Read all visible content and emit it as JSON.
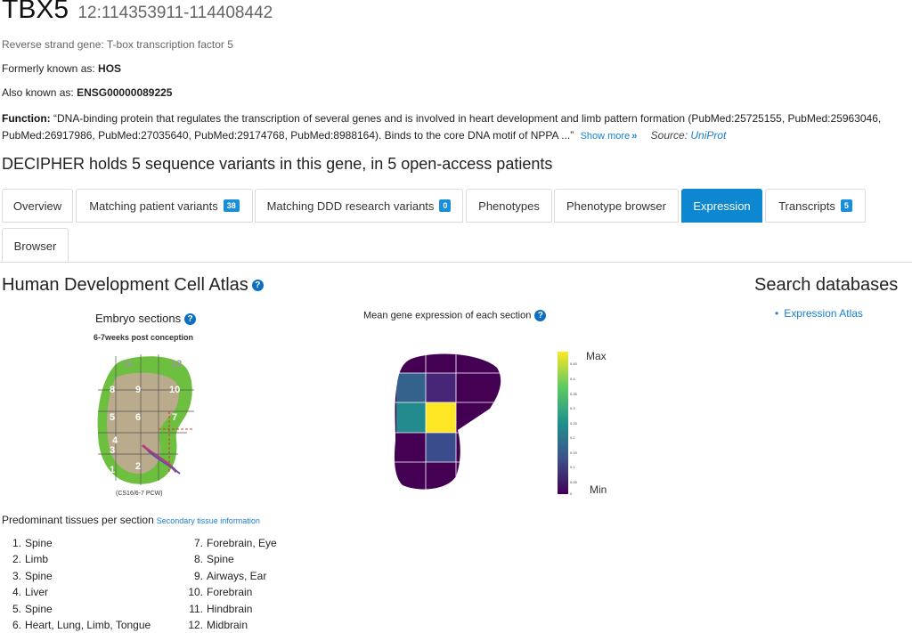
{
  "gene": {
    "symbol": "TBX5",
    "location": "12:114353911-114408442",
    "strand_text": "Reverse strand gene: T-box transcription factor 5",
    "formerly_label": "Formerly known as:",
    "formerly_value": "HOS",
    "aka_label": "Also known as:",
    "aka_value": "ENSG00000089225",
    "function_label": "Function:",
    "function_text": "“DNA-binding protein that regulates the transcription of several genes and is involved in heart development and limb pattern formation (PubMed:25725155, PubMed:25963046, PubMed:26917986, PubMed:27035640, PubMed:29174768, PubMed:8988164). Binds to the core DNA motif of NPPA ...”",
    "show_more": "Show more",
    "show_more_chevron": "»",
    "source_label": "Source:",
    "source_value": "UniProt"
  },
  "summary": "DECIPHER holds 5 sequence variants in this gene, in 5 open-access patients",
  "tabs": [
    {
      "label": "Overview",
      "badge": ""
    },
    {
      "label": "Matching patient variants",
      "badge": "38"
    },
    {
      "label": "Matching DDD research variants",
      "badge": "0"
    },
    {
      "label": "Phenotypes",
      "badge": ""
    },
    {
      "label": "Phenotype browser",
      "badge": ""
    },
    {
      "label": "Expression",
      "badge": "",
      "active": true
    },
    {
      "label": "Transcripts",
      "badge": "5"
    },
    {
      "label": "Browser",
      "badge": ""
    }
  ],
  "hdca": {
    "title": "Human Development Cell Atlas",
    "help": "?",
    "embryo_title": "Embryo sections",
    "embryo_sub": "6-7weeks post conception",
    "embryo_caption": "(CS16/6-7 PCW)",
    "embryo_section_numbers": [
      "1",
      "2",
      "3",
      "4",
      "5",
      "6",
      "7",
      "8",
      "9",
      "10",
      "11",
      "12"
    ],
    "mean_title": "Mean gene expression of each section",
    "legend_max": "Max",
    "legend_min": "Min",
    "legend_ticks": [
      "0.45",
      "0.4",
      "0.35",
      "0.3",
      "0.25",
      "0.2",
      "0.15",
      "0.1",
      "0.05",
      "0"
    ]
  },
  "search": {
    "title": "Search databases",
    "items": [
      "Expression Atlas"
    ]
  },
  "tissues": {
    "title": "Predominant tissues per section",
    "secondary_link": "Secondary tissue information",
    "col1": [
      {
        "n": "1.",
        "t": "Spine"
      },
      {
        "n": "2.",
        "t": "Limb"
      },
      {
        "n": "3.",
        "t": "Spine"
      },
      {
        "n": "4.",
        "t": "Liver"
      },
      {
        "n": "5.",
        "t": "Spine"
      },
      {
        "n": "6.",
        "t": "Heart, Lung, Limb, Tongue"
      }
    ],
    "col2": [
      {
        "n": "7.",
        "t": "Forebrain, Eye"
      },
      {
        "n": "8.",
        "t": "Spine"
      },
      {
        "n": "9.",
        "t": "Airways, Ear"
      },
      {
        "n": "10.",
        "t": "Forebrain"
      },
      {
        "n": "11.",
        "t": "Hindbrain"
      },
      {
        "n": "12.",
        "t": "Midbrain"
      }
    ]
  },
  "colors": {
    "accent": "#0c87d0",
    "link": "#1a7fcf",
    "heatmap_dark": "#440154",
    "heatmap_purple": "#482677",
    "heatmap_blue": "#33638d",
    "heatmap_teal": "#238a8d",
    "heatmap_yellow": "#fde725"
  }
}
